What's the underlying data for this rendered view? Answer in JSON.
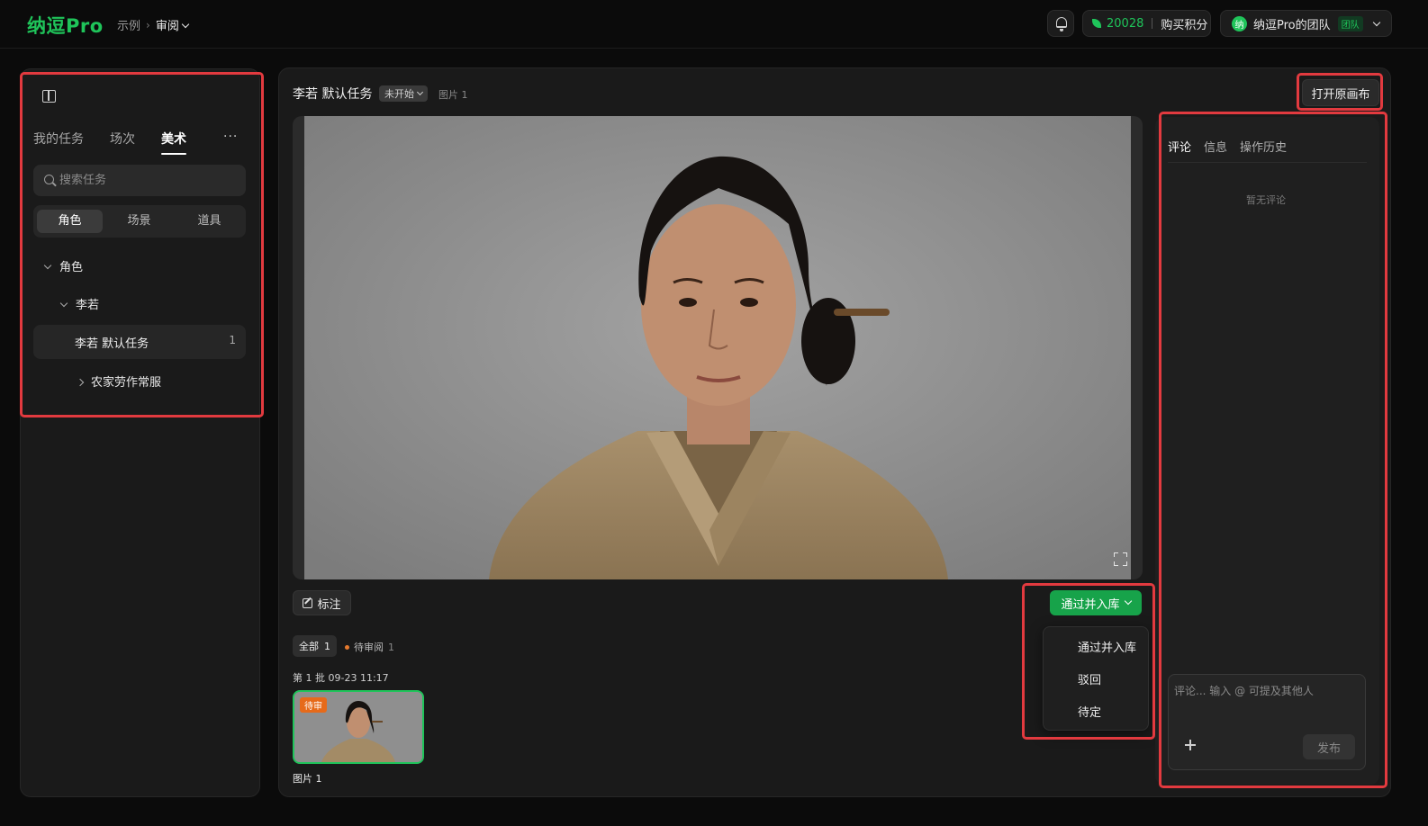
{
  "app": {
    "logo": "纳逗Pro"
  },
  "breadcrumb": {
    "root": "示例",
    "current": "审阅"
  },
  "header": {
    "points": "20028",
    "buy_label": "购买积分",
    "team_avatar": "纳",
    "team_name": "纳逗Pro的团队",
    "team_badge": "团队"
  },
  "sidebar": {
    "tabs": [
      "我的任务",
      "场次",
      "美术"
    ],
    "active_tab": "美术",
    "more": "···",
    "search_placeholder": "搜索任务",
    "segments": [
      "角色",
      "场景",
      "道具"
    ],
    "active_segment": "角色",
    "tree": {
      "root": "角色",
      "child": "李若",
      "task": {
        "label": "李若 默认任务",
        "count": "1"
      },
      "collapsed": "农家劳作常服"
    }
  },
  "main": {
    "title": "李若 默认任务",
    "status": "未开始",
    "image_count": "图片 1",
    "open_canvas": "打开原画布",
    "annotate": "标注",
    "approve": "通过并入库",
    "dropdown": [
      "通过并入库",
      "驳回",
      "待定"
    ],
    "filters": {
      "all_label": "全部",
      "all_count": "1",
      "pending_label": "待审阅",
      "pending_count": "1"
    },
    "batch": "第 1 批 09-23 11:17",
    "thumb": {
      "badge": "待审",
      "caption": "图片 1"
    }
  },
  "comments": {
    "tabs": [
      "评论",
      "信息",
      "操作历史"
    ],
    "active_tab": "评论",
    "empty": "暂无评论",
    "placeholder": "评论... 输入 @ 可提及其他人",
    "publish": "发布"
  },
  "colors": {
    "accent": "#1fc45a",
    "highlight": "#e23a3f",
    "pending": "#e66a1a"
  }
}
